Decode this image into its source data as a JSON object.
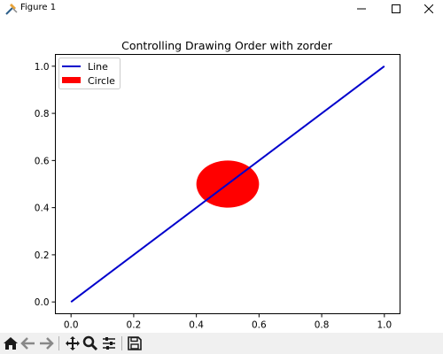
{
  "window": {
    "title": "Figure 1",
    "icons": [
      "matplotlib-icon",
      "minimize-icon",
      "maximize-icon",
      "close-icon"
    ]
  },
  "chart_data": {
    "type": "line",
    "title": "Controlling Drawing Order with zorder",
    "xlabel": "",
    "ylabel": "",
    "xlim": [
      -0.05,
      1.05
    ],
    "ylim": [
      -0.05,
      1.05
    ],
    "xticks": [
      0.0,
      0.2,
      0.4,
      0.6,
      0.8,
      1.0
    ],
    "yticks": [
      0.0,
      0.2,
      0.4,
      0.6,
      0.8,
      1.0
    ],
    "xtick_labels": [
      "0.0",
      "0.2",
      "0.4",
      "0.6",
      "0.8",
      "1.0"
    ],
    "ytick_labels": [
      "0.0",
      "0.2",
      "0.4",
      "0.6",
      "0.8",
      "1.0"
    ],
    "grid": false,
    "legend": {
      "placement": "upper-left",
      "entries": [
        "Line",
        "Circle"
      ]
    },
    "series": [
      {
        "name": "Line",
        "kind": "line",
        "color": "#0000cc",
        "x": [
          0,
          1
        ],
        "y": [
          0,
          1
        ]
      }
    ],
    "shapes": [
      {
        "name": "Circle",
        "kind": "circle",
        "color": "#ff0000",
        "center": [
          0.5,
          0.5
        ],
        "radius": 0.1
      }
    ]
  },
  "toolbar": {
    "icons": [
      "home-icon",
      "back-icon",
      "forward-icon",
      "pan-icon",
      "zoom-icon",
      "configure-subplots-icon",
      "save-icon"
    ]
  }
}
